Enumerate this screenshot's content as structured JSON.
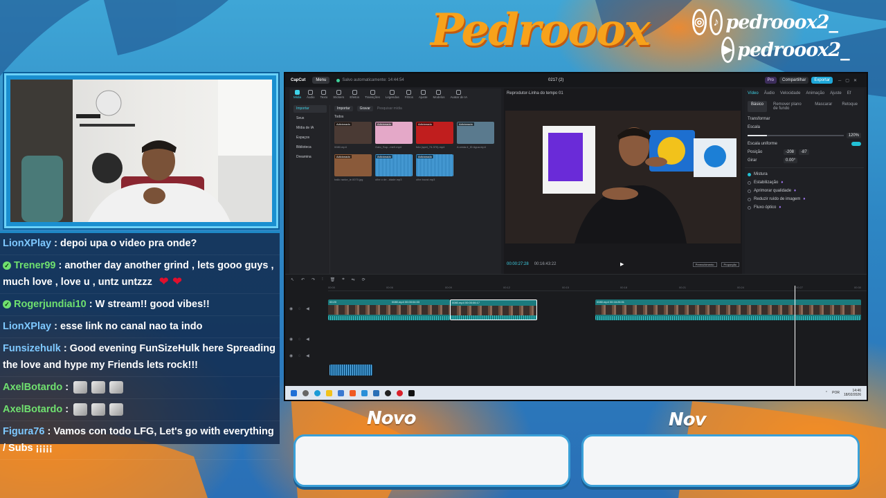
{
  "brand": {
    "title": "Pedrooox"
  },
  "social": {
    "handles": [
      {
        "icon": "instagram-tiktok-icons",
        "handle": "pedrooox2_"
      },
      {
        "icon": "youtube-icon",
        "handle": "pedrooox2_"
      }
    ]
  },
  "chat": {
    "messages": [
      {
        "user": "LionXPlay",
        "verified": false,
        "text": "depoi upa o video pra onde?"
      },
      {
        "user": "Trener99",
        "verified": true,
        "text": "another day another grind , lets gooo guys , much love , love u , untz untzzz",
        "hearts": 2
      },
      {
        "user": "Rogerjundiai10",
        "verified": true,
        "text": "W stream!! good vibes!!"
      },
      {
        "user": "LionXPlay",
        "verified": false,
        "text": "esse link no canal nao ta indo"
      },
      {
        "user": "Funsizehulk",
        "verified": false,
        "text": "Good evening FunSizeHulk here Spreading the love and hype my Friends lets rock!!!"
      },
      {
        "user": "AxelBotardo",
        "verified": false,
        "emotes": 3
      },
      {
        "user": "AxelBotardo",
        "verified": false,
        "emotes": 3
      },
      {
        "user": "Figura76",
        "verified": false,
        "text": "Vamos con todo LFG, Let's go with everything / Subs ¡¡¡¡¡"
      }
    ]
  },
  "editor": {
    "app": "CapCut",
    "menu": "Menu",
    "save_status": "Salvo automaticamente: 14:44:54",
    "project": "0217 (2)",
    "pro": "Pro",
    "share": "Compartilhar",
    "export": "Exportar",
    "media_tabs": [
      "Mídia",
      "Áudio",
      "Texto",
      "Stickers",
      "Efeitos",
      "Transições",
      "Legendas",
      "Filtros",
      "Ajuste",
      "Modelos",
      "Avatar de IA"
    ],
    "side_items": [
      "Importar",
      "Seus",
      "Mídia de IA",
      "Espaços",
      "Biblioteca",
      "Dreamina"
    ],
    "import": "Importar",
    "record": "Gravar",
    "search_placeholder": "Pesquisar mídia",
    "all": "Todos",
    "thumbs": [
      {
        "badge": "Adicionado",
        "name": "0080.mp4",
        "color": "#4a3a34"
      },
      {
        "badge": "Adicionado",
        "name": "Gato_Sup...me0.mp4",
        "color": "#e4a8c8"
      },
      {
        "badge": "Adicionado",
        "name": "foto (spet_74.370).mp4",
        "color": "#c01e1e"
      },
      {
        "badge": "Adicionado",
        "name": "A cesta é_ID Agua.mp4",
        "color": "#5a7a8e"
      },
      {
        "badge": "Adicionado",
        "name": "hallo ranke_ie.0070.jpg",
        "color": "#8a5a3a"
      },
      {
        "badge": "Adicionado",
        "name": "olhe o de...idade.mp3",
        "color": "#1f6fa8"
      },
      {
        "badge": "Adicionado",
        "name": "olhe boost.mp3",
        "color": "#1f6fa8"
      }
    ],
    "player": {
      "title": "Reprodutor-Linha do tempo 01",
      "current": "00:00:27:28",
      "total": "00:16:43:22",
      "chip1": "Preenchimento",
      "chip2": "Proporção"
    },
    "inspector": {
      "tabs": [
        "Vídeo",
        "Áudio",
        "Velocidade",
        "Animação",
        "Ajuste",
        "Ef"
      ],
      "subtabs": [
        "Básico",
        "Remover plano de fundo",
        "Mascarar",
        "Retoque"
      ],
      "transform": "Transformar",
      "scale_label": "Escala",
      "scale_value": "120%",
      "scale_fraction": 0.2,
      "uniform_label": "Escala uniforme",
      "position_label": "Posição",
      "pos_x": "-208",
      "pos_y": "-87",
      "rotate_label": "Girar",
      "rotate_value": "0.00°",
      "blend_label": "Mistura",
      "stabilize": "Estabilização",
      "enhance": "Aprimorar qualidade",
      "denoise": "Reduzir ruído de imagem",
      "optical_flow": "Fluxo óptico"
    },
    "timeline": {
      "ruler": [
        "00:00",
        "00:06",
        "00:09",
        "00:12",
        "00:15",
        "00:18",
        "00:21",
        "00:24",
        "00:27",
        "00:30"
      ],
      "clips": [
        {
          "label": "00:20"
        },
        {
          "label": "0080.mp4  00:00:04:03"
        },
        {
          "label": "0080.mp4  00:00:06:17"
        },
        {
          "label": "0080.mp4  00:16:26:01"
        }
      ]
    },
    "taskbar": {
      "lang": "POR",
      "time": "14:46",
      "date": "18/02/2026"
    }
  },
  "cards": [
    {
      "title": "Novo"
    },
    {
      "title": "Nov"
    }
  ],
  "colors": {
    "accent": "#3fd3e8",
    "brand": "#f7a21b",
    "card_border": "#3aa0d8"
  }
}
